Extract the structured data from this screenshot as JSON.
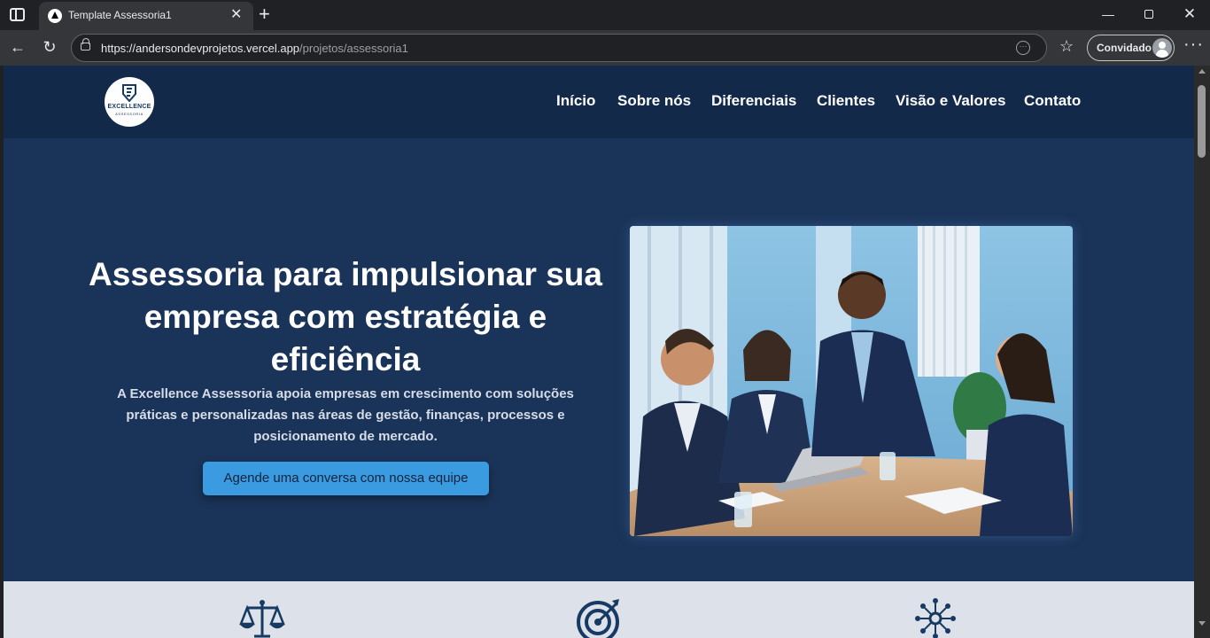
{
  "browser": {
    "tab_title": "Template Assessoria1",
    "url_host": "https://andersondevprojetos.vercel.app",
    "url_path": "/projetos/assessoria1",
    "profile_label": "Convidado"
  },
  "site": {
    "logo": {
      "name": "EXCELLENCE",
      "sub": "ASSESSORIA"
    },
    "nav": [
      "Início",
      "Sobre nós",
      "Diferenciais",
      "Clientes",
      "Visão e Valores",
      "Contato"
    ],
    "hero": {
      "title": "Assessoria para impulsionar sua empresa com estratégia e eficiência",
      "description": "A Excellence Assessoria apoia empresas em crescimento com soluções práticas e personalizadas nas áreas de gestão, finanças, processos e posicionamento de mercado.",
      "cta": "Agende uma conversa com nossa equipe",
      "image": "business-meeting-photo"
    },
    "features": [
      {
        "icon": "scales-icon"
      },
      {
        "icon": "target-icon"
      },
      {
        "icon": "network-icon"
      }
    ]
  },
  "colors": {
    "header": "#13294a",
    "hero_bg": "#1a3358",
    "cta": "#3a9be0",
    "features_bg": "#dde2ea"
  }
}
